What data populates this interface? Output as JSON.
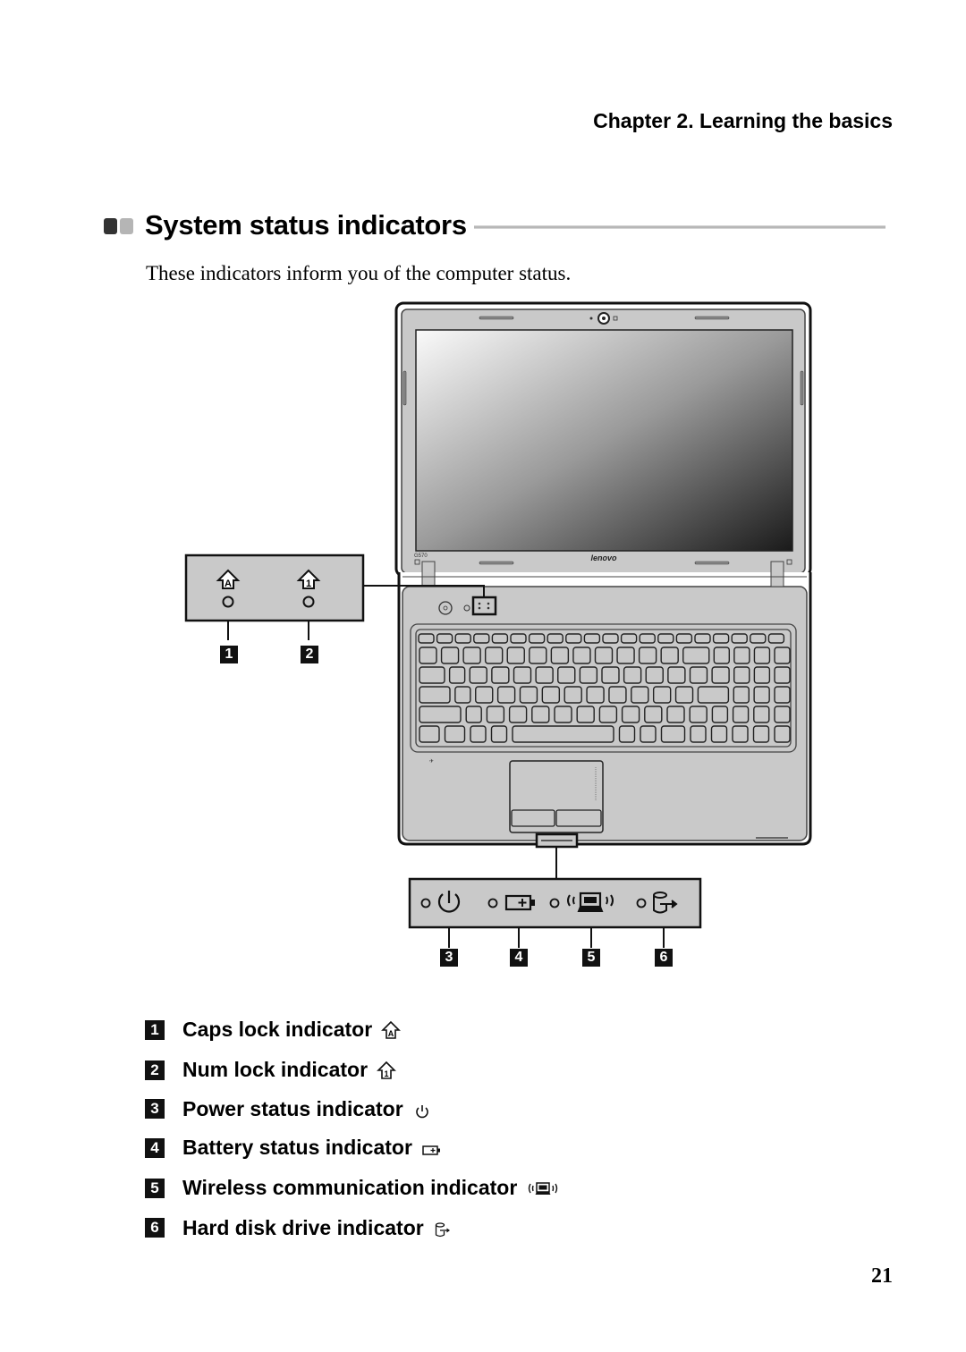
{
  "header": {
    "chapter": "Chapter 2. Learning the basics"
  },
  "section": {
    "title": "System status indicators",
    "intro": "These indicators inform you of the computer status."
  },
  "figure": {
    "laptop": {
      "brand_label": "lenovo",
      "model_label": "G570"
    },
    "callout_top": {
      "items": [
        {
          "num": "1",
          "icon": "caps-lock-icon"
        },
        {
          "num": "2",
          "icon": "num-lock-icon"
        }
      ]
    },
    "callout_bottom": {
      "items": [
        {
          "num": "3",
          "icon": "power-icon"
        },
        {
          "num": "4",
          "icon": "battery-icon"
        },
        {
          "num": "5",
          "icon": "wireless-icon"
        },
        {
          "num": "6",
          "icon": "hard-disk-icon"
        }
      ]
    }
  },
  "legend": [
    {
      "num": "1",
      "label": "Caps lock indicator",
      "icon": "caps-lock-icon"
    },
    {
      "num": "2",
      "label": "Num lock indicator",
      "icon": "num-lock-icon"
    },
    {
      "num": "3",
      "label": "Power status indicator",
      "icon": "power-icon"
    },
    {
      "num": "4",
      "label": "Battery status indicator",
      "icon": "battery-icon"
    },
    {
      "num": "5",
      "label": "Wireless communication indicator",
      "icon": "wireless-icon"
    },
    {
      "num": "6",
      "label": "Hard disk drive indicator",
      "icon": "hard-disk-icon"
    }
  ],
  "footer": {
    "page_number": "21"
  },
  "colors": {
    "bullet_dark": "#333333",
    "bullet_light": "#b5b5b5",
    "panel_gray": "#c8c8c8"
  }
}
